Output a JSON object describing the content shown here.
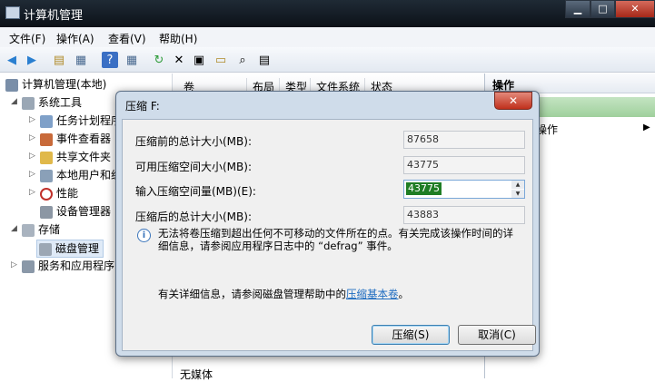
{
  "window": {
    "title": "计算机管理"
  },
  "menu": [
    "文件(F)",
    "操作(A)",
    "查看(V)",
    "帮助(H)"
  ],
  "tree": {
    "root": "计算机管理(本地)",
    "system_tools": "系统工具",
    "children": [
      "任务计划程序",
      "事件查看器",
      "共享文件夹",
      "本地用户和组",
      "性能",
      "设备管理器"
    ],
    "storage": "存储",
    "disk_management": "磁盘管理",
    "services": "服务和应用程序"
  },
  "list": {
    "columns": [
      "卷",
      "布局",
      "类型",
      "文件系统",
      "状态"
    ],
    "bottom_row": "无媒体"
  },
  "actions": {
    "header": "操作",
    "item": "操作"
  },
  "dialog": {
    "title": "压缩 F:",
    "labels": {
      "total_before": "压缩前的总计大小(MB):",
      "available": "可用压缩空间大小(MB):",
      "input": "输入压缩空间量(MB)(E):",
      "total_after": "压缩后的总计大小(MB):"
    },
    "values": {
      "total_before": "87658",
      "available": "43775",
      "input": "43775",
      "total_after": "43883"
    },
    "info_text": "无法将卷压缩到超出任何不可移动的文件所在的点。有关完成该操作时间的详细信息，请参阅应用程序日志中的 “defrag” 事件。",
    "help_prefix": "有关详细信息，请参阅磁盘管理帮助中的",
    "help_link": "压缩基本卷",
    "help_suffix": "。",
    "ok_label": "压缩(S)",
    "cancel_label": "取消(C)"
  }
}
